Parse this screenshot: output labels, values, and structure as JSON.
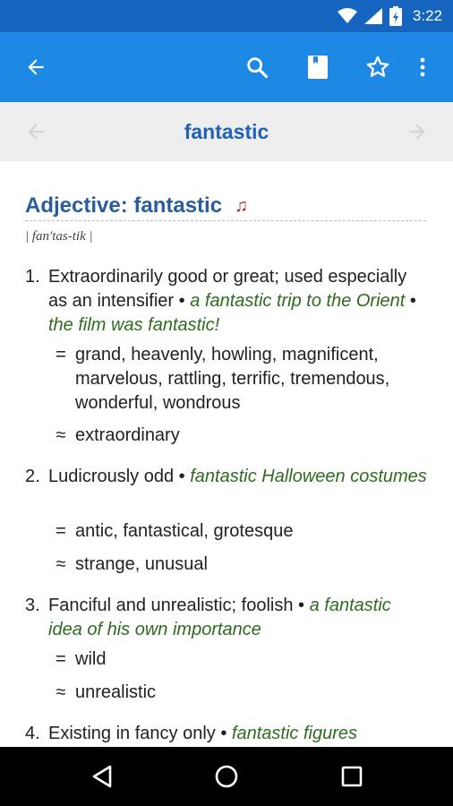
{
  "status": {
    "time": "3:22"
  },
  "word_bar": {
    "word": "fantastic"
  },
  "entry": {
    "heading": "Adjective: fantastic",
    "pronunciation": "| fan'tas-tik |",
    "senses": [
      {
        "num": "1.",
        "definition": "Extraordinarily good or great; used especially as an intensifier",
        "examples": [
          "a fantastic trip to the Orient",
          "the film was fantastic!"
        ],
        "synonyms": "grand, heavenly, howling, magnificent, marvelous, rattling, terrific, tremendous, wonderful, wondrous",
        "similar": "extraordinary"
      },
      {
        "num": "2.",
        "definition": "Ludicrously odd",
        "examples": [
          "fantastic Halloween costumes"
        ],
        "synonyms": "antic, fantastical, grotesque",
        "similar": "strange, unusual"
      },
      {
        "num": "3.",
        "definition": "Fanciful and unrealistic; foolish",
        "examples": [
          "a fantastic idea of his own importance"
        ],
        "synonyms": "wild",
        "similar": "unrealistic"
      },
      {
        "num": "4.",
        "definition": "Existing in fancy only",
        "examples": [
          "fantastic figures"
        ]
      }
    ],
    "symbols": {
      "synonym": "=",
      "similar": "≈",
      "bullet": "•"
    }
  },
  "icons": {
    "back": "arrow-back-icon",
    "search": "search-icon",
    "bookmark": "bookmark-icon",
    "favorite": "star-outline-icon",
    "more": "more-vert-icon",
    "prev": "arrow-left-icon",
    "next": "arrow-right-icon",
    "sound": "music-note-icon"
  },
  "colors": {
    "app_bar": "#1e88e5",
    "status_bar": "#1565c0",
    "heading": "#2a5e9b",
    "example": "#2e6b1f",
    "sound_icon": "#b71c1c"
  }
}
